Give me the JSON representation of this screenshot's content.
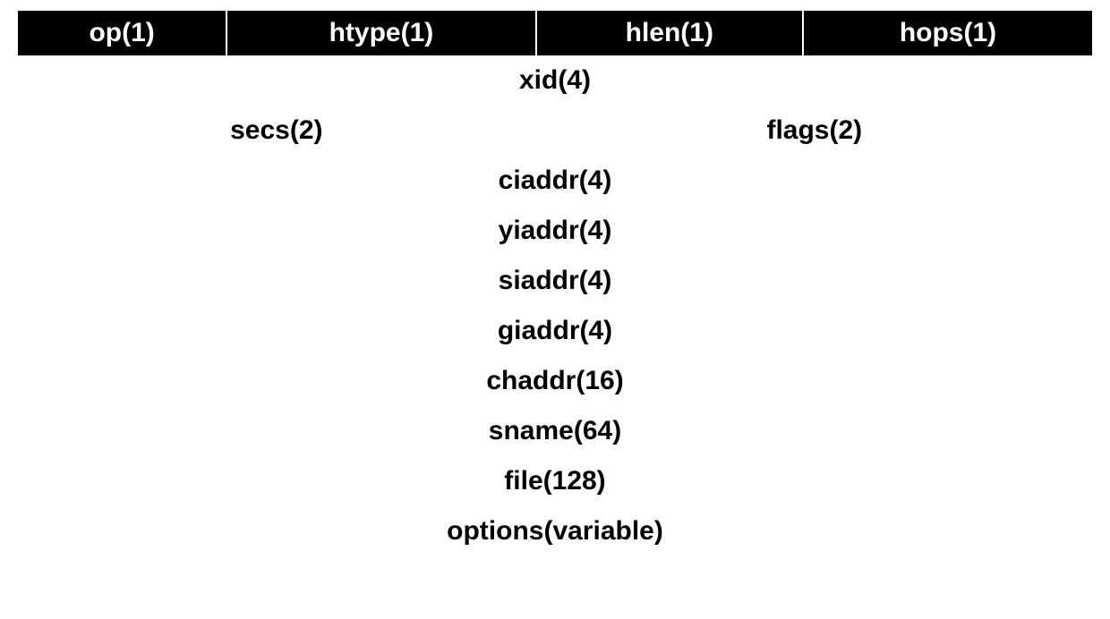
{
  "header": {
    "op": "op(1)",
    "htype": "htype(1)",
    "hlen": "hlen(1)",
    "hops": "hops(1)"
  },
  "rows": {
    "xid": "xid(4)",
    "secs": "secs(2)",
    "flags": "flags(2)",
    "ciaddr": "ciaddr(4)",
    "yiaddr": "yiaddr(4)",
    "siaddr": "siaddr(4)",
    "giaddr": "giaddr(4)",
    "chaddr": "chaddr(16)",
    "sname": "sname(64)",
    "file": "file(128)",
    "options": "options(variable)"
  }
}
